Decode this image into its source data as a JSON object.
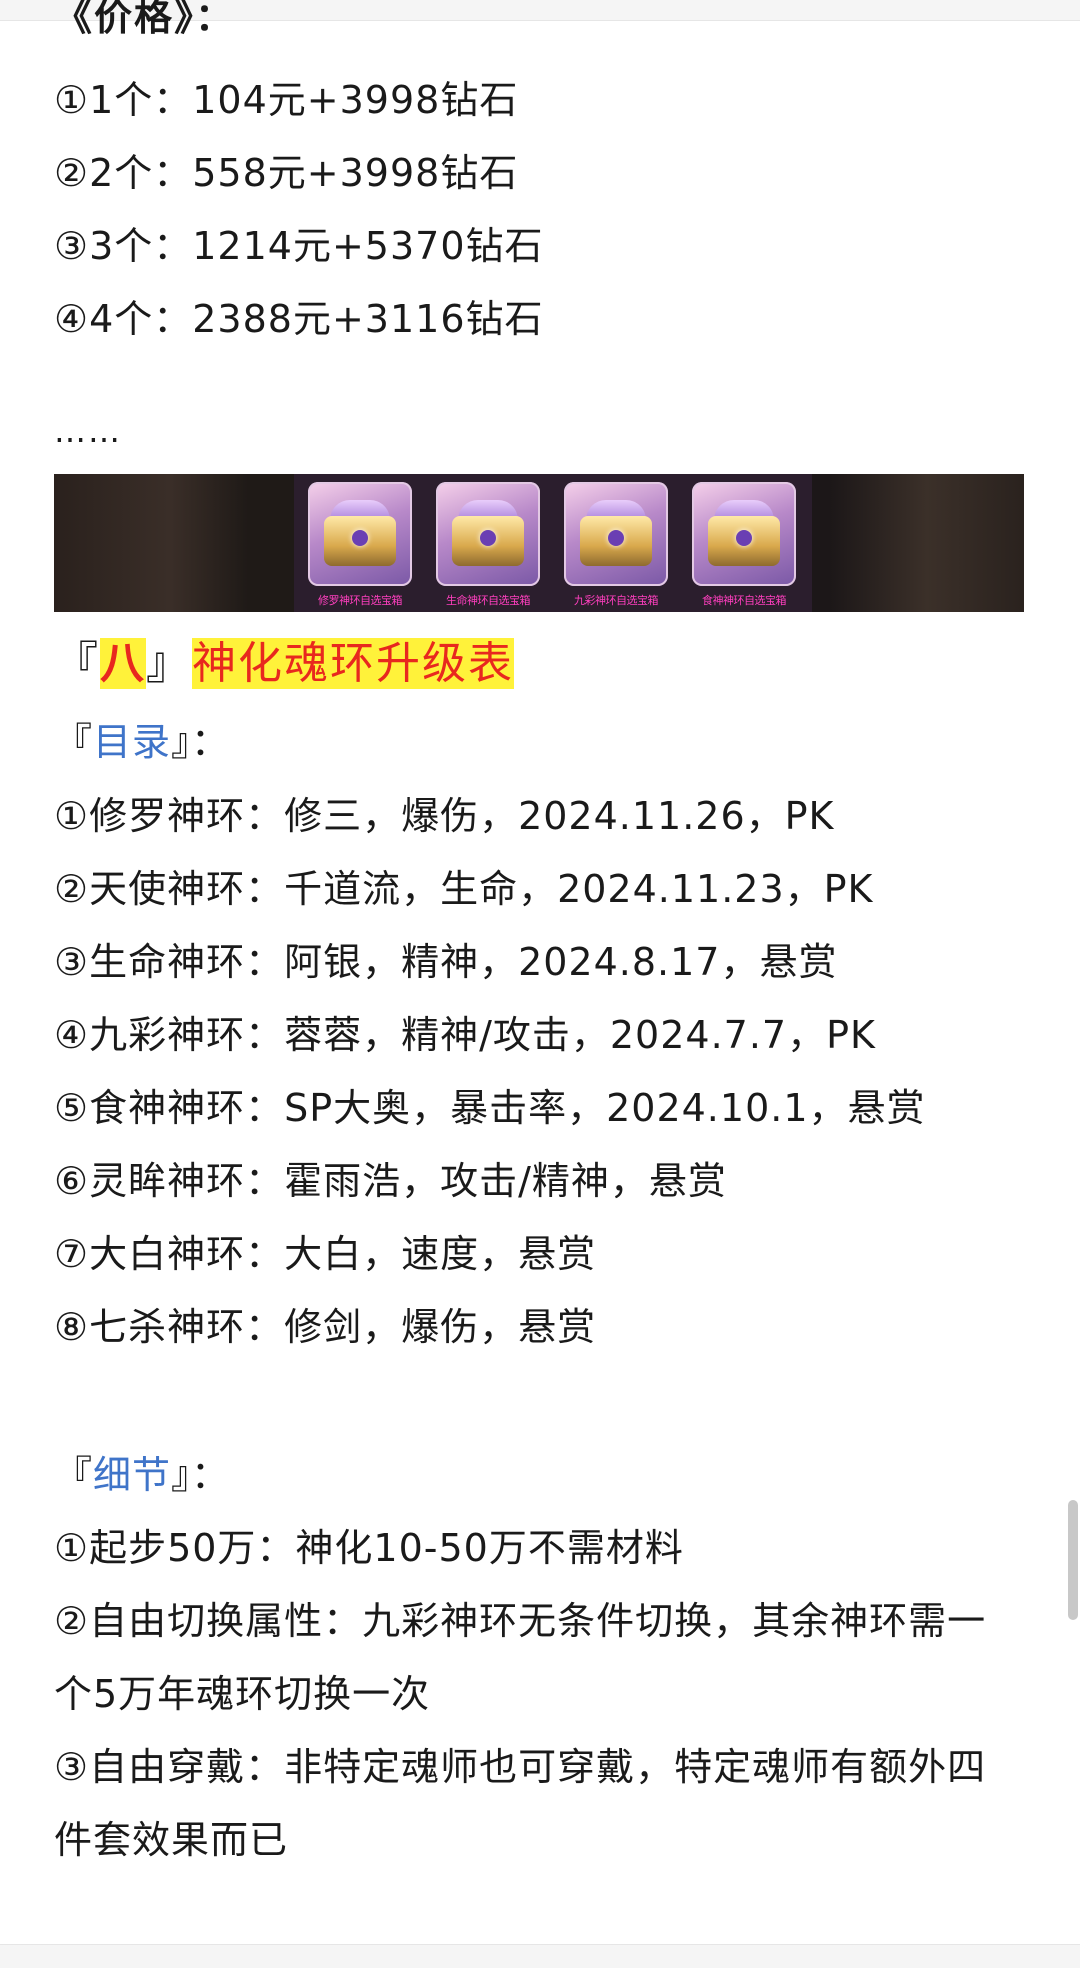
{
  "price_section": {
    "heading": "《价格》：",
    "items": [
      "①1个：104元+3998钻石",
      "②2个：558元+3998钻石",
      "③3个：1214元+5370钻石",
      "④4个：2388元+3116钻石"
    ],
    "ellipsis": "……"
  },
  "banner": {
    "chests": [
      {
        "label": "修罗神环自选宝箱"
      },
      {
        "label": "生命神环自选宝箱"
      },
      {
        "label": "九彩神环自选宝箱"
      },
      {
        "label": "食神神环自选宝箱"
      }
    ]
  },
  "section": {
    "bracket_open": "『",
    "number": "八",
    "bracket_close": "』",
    "title": "神化魂环升级表"
  },
  "catalog": {
    "open": "『",
    "label": "目录",
    "close": "』：",
    "items": [
      "①修罗神环：修三，爆伤，2024.11.26，PK",
      "②天使神环：千道流，生命，2024.11.23，PK",
      "③生命神环：阿银，精神，2024.8.17，悬赏",
      "④九彩神环：蓉蓉，精神/攻击，2024.7.7，PK",
      "⑤食神神环：SP大奥，暴击率，2024.10.1，悬赏",
      "⑥灵眸神环：霍雨浩，攻击/精神，悬赏",
      "⑦大白神环：大白，速度，悬赏",
      "⑧七杀神环：修剑，爆伤，悬赏"
    ]
  },
  "details": {
    "open": "『",
    "label": "细节",
    "close": "』：",
    "lines": [
      "①起步50万：神化10-50万不需材料",
      "②自由切换属性：九彩神环无条件切换，其余神环需一",
      "个5万年魂环切换一次",
      "③自由穿戴：非特定魂师也可穿戴，特定魂师有额外四",
      "件套效果而已"
    ]
  },
  "colors": {
    "highlight": "#fff23a",
    "title_red": "#e8281e",
    "label_blue": "#3f74c9"
  }
}
